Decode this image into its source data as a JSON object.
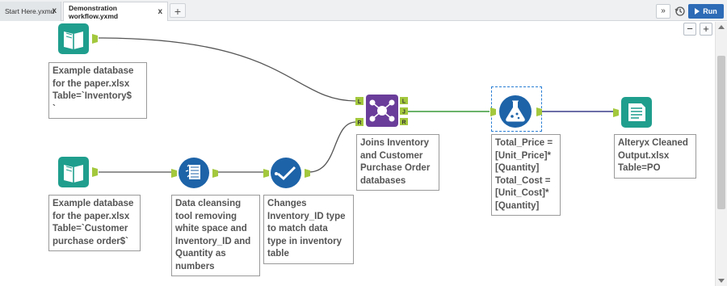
{
  "tabs": [
    {
      "label": "Start Here.yxmd",
      "close": "x"
    },
    {
      "label": "Demonstration workflow.yxmd",
      "close": "x"
    }
  ],
  "add_tab": "+",
  "toolbar": {
    "overflow": "»",
    "history_icon": "history-icon",
    "run_label": "Run"
  },
  "zoom": {
    "out": "−",
    "in": "+"
  },
  "tools": {
    "input1": {
      "icon": "book-input-icon",
      "note": "Example database\nfor the paper.xlsx\nTable=`Inventory$\n`"
    },
    "input2": {
      "icon": "book-input-icon",
      "note": "Example database\nfor the paper.xlsx\nTable=`Customer\npurchase order$`"
    },
    "cleanse": {
      "icon": "data-cleansing-icon",
      "note": "Data cleansing\ntool removing\nwhite space and\nInventory_ID and\nQuantity as\nnumbers"
    },
    "select": {
      "icon": "select-check-icon",
      "note": "Changes\nInventory_ID type\nto match data\ntype in inventory\ntable"
    },
    "join": {
      "icon": "join-icon",
      "note": "Joins Inventory\nand Customer\nPurchase Order\ndatabases",
      "anchors": [
        "L",
        "R",
        "L",
        "J",
        "R"
      ]
    },
    "formula": {
      "icon": "formula-flask-icon",
      "note": "Total_Price =\n[Unit_Price]*\n[Quantity]\nTotal_Cost =\n[Unit_Cost]*\n[Quantity]"
    },
    "output": {
      "icon": "output-icon",
      "note": "Alteryx Cleaned\nOutput.xlsx\nTable=PO"
    }
  },
  "colors": {
    "input": "#1f9e8e",
    "cleanse": "#1d63a8",
    "select": "#1d63a8",
    "join": "#6b3d9b",
    "formula": "#1d63a8",
    "output": "#1f9e8e",
    "anchor": "#a4c83d",
    "run": "#2d6bb6"
  }
}
